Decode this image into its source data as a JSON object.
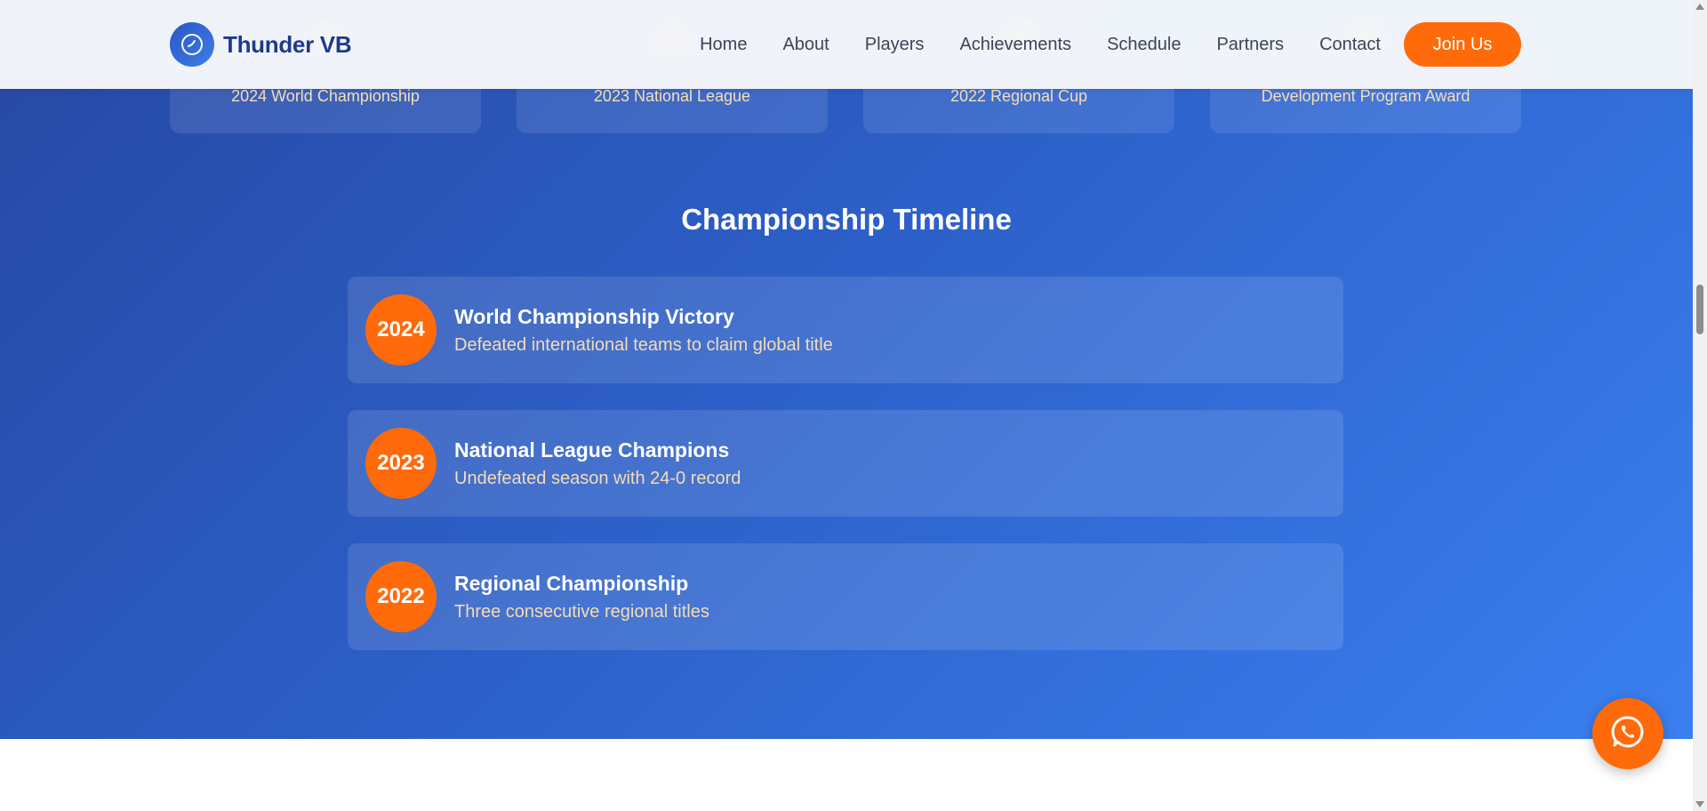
{
  "header": {
    "logo_text": "Thunder VB",
    "nav": [
      "Home",
      "About",
      "Players",
      "Achievements",
      "Schedule",
      "Partners",
      "Contact"
    ],
    "cta_label": "Join Us"
  },
  "awards": [
    {
      "label": "2024 World Championship"
    },
    {
      "label": "2023 National League"
    },
    {
      "label": "2022 Regional Cup"
    },
    {
      "label": "Development Program Award"
    }
  ],
  "timeline": {
    "title": "Championship Timeline",
    "items": [
      {
        "year": "2024",
        "title": "World Championship Victory",
        "description": "Defeated international teams to claim global title"
      },
      {
        "year": "2023",
        "title": "National League Champions",
        "description": "Undefeated season with 24-0 record"
      },
      {
        "year": "2022",
        "title": "Regional Championship",
        "description": "Three consecutive regional titles"
      }
    ]
  },
  "icons": {
    "logo": "volleyball-icon",
    "floating_action": "whatsapp-icon"
  },
  "colors": {
    "primary": "#1e3a8a",
    "accent": "#ff6b0a",
    "section_gradient_start": "#2748a3",
    "section_gradient_end": "#3a7ff0"
  }
}
